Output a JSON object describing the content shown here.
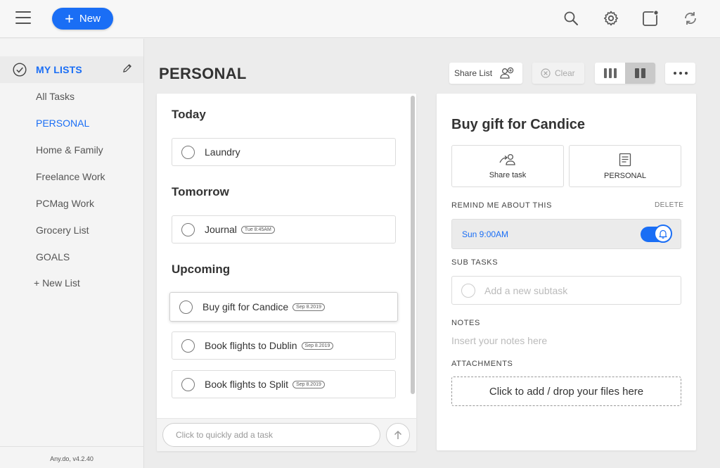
{
  "topbar": {
    "new_button_label": "New",
    "icons": [
      "hamburger-icon",
      "search-icon",
      "gear-icon",
      "notification-square-icon",
      "sync-icon"
    ]
  },
  "sidebar": {
    "header": "MY LISTS",
    "items": [
      {
        "label": "All Tasks",
        "active": false
      },
      {
        "label": "PERSONAL",
        "active": true
      },
      {
        "label": "Home & Family",
        "active": false
      },
      {
        "label": "Freelance Work",
        "active": false
      },
      {
        "label": "PCMag Work",
        "active": false
      },
      {
        "label": "Grocery List",
        "active": false
      },
      {
        "label": "GOALS",
        "active": false
      }
    ],
    "new_list_label": "+ New List",
    "version": "Any.do, v4.2.40"
  },
  "main": {
    "title": "PERSONAL",
    "share_list_label": "Share List",
    "clear_label": "Clear"
  },
  "tasks": {
    "sections": [
      {
        "title": "Today",
        "items": [
          {
            "name": "Laundry",
            "date": ""
          }
        ]
      },
      {
        "title": "Tomorrow",
        "items": [
          {
            "name": "Journal",
            "date": "Tue 8:45AM"
          }
        ]
      },
      {
        "title": "Upcoming",
        "items": [
          {
            "name": "Buy gift for Candice",
            "date": "Sep 8.2019",
            "selected": true
          },
          {
            "name": "Book flights to Dublin",
            "date": "Sep 8.2019"
          },
          {
            "name": "Book flights to Split",
            "date": "Sep 8.2019"
          }
        ]
      }
    ],
    "quick_add_placeholder": "Click to quickly add a task"
  },
  "detail": {
    "title": "Buy gift for Candice",
    "share_task_label": "Share task",
    "list_label": "PERSONAL",
    "remind_heading": "REMIND ME ABOUT THIS",
    "delete_label": "DELETE",
    "reminder_time": "Sun 9:00AM",
    "reminder_enabled": true,
    "subtasks_heading": "SUB TASKS",
    "subtask_placeholder": "Add a new subtask",
    "notes_heading": "NOTES",
    "notes_placeholder": "Insert your notes here",
    "attachments_heading": "ATTACHMENTS",
    "drop_label": "Click to add / drop your files here"
  },
  "colors": {
    "accent": "#1a6ef5",
    "background": "#ececec",
    "panel": "#ffffff"
  }
}
